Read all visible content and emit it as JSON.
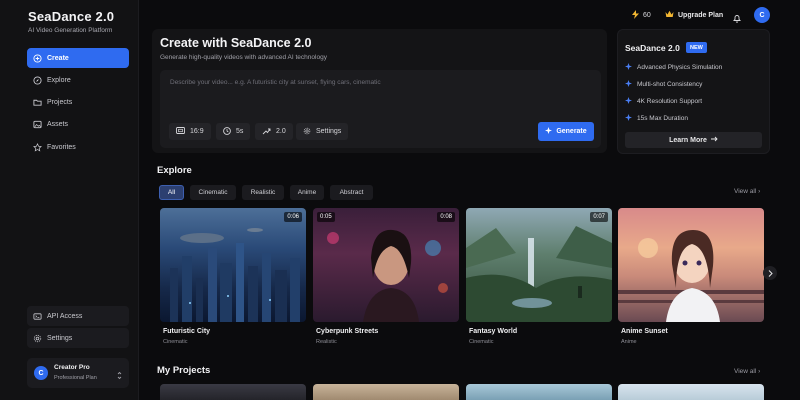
{
  "sidebar": {
    "brand": "SeaDance 2.0",
    "tagline": "AI Video Generation Platform",
    "nav": [
      {
        "label": "Create",
        "icon": "plus-circle-icon",
        "active": true
      },
      {
        "label": "Explore",
        "icon": "compass-icon"
      },
      {
        "label": "Projects",
        "icon": "folder-icon"
      },
      {
        "label": "Assets",
        "icon": "image-icon"
      },
      {
        "label": "Favorites",
        "icon": "star-icon"
      }
    ],
    "bottom": [
      {
        "label": "API Access",
        "icon": "code-icon"
      },
      {
        "label": "Settings",
        "icon": "gear-icon"
      }
    ],
    "user": {
      "initial": "C",
      "name": "Creator Pro",
      "plan": "Professional Plan"
    }
  },
  "topbar": {
    "credits": "60",
    "upgrade_label": "Upgrade Plan",
    "avatar_initial": "C"
  },
  "create": {
    "title": "Create with SeaDance 2.0",
    "subtitle": "Generate high-quality videos with advanced AI technology",
    "placeholder": "Describe your video... e.g. A futuristic city at sunset, flying cars, cinematic",
    "aspect": "16:9",
    "duration": "5s",
    "model": "2.0",
    "settings_label": "Settings",
    "generate_label": "Generate"
  },
  "info": {
    "title": "SeaDance 2.0",
    "badge": "NEW",
    "features": [
      "Advanced Physics Simulation",
      "Multi-shot Consistency",
      "4K Resolution Support",
      "15s Max Duration"
    ],
    "learn_label": "Learn More"
  },
  "explore": {
    "title": "Explore",
    "view_all": "View all",
    "filters": [
      "All",
      "Cinematic",
      "Realistic",
      "Anime",
      "Abstract"
    ],
    "cards": [
      {
        "title": "Futuristic City",
        "tag": "Cinematic",
        "duration": "0:06"
      },
      {
        "title": "Cyberpunk Streets",
        "tag": "Realistic",
        "duration": "0:05",
        "duration_alt": "0:08"
      },
      {
        "title": "Fantasy World",
        "tag": "Cinematic",
        "duration": "0:07"
      },
      {
        "title": "Anime Sunset",
        "tag": "Anime",
        "duration": ""
      }
    ]
  },
  "projects": {
    "title": "My Projects",
    "view_all": "View all"
  },
  "colors": {
    "accent": "#2f6bf0",
    "background": "#0b0b0d",
    "panel": "#141416"
  }
}
